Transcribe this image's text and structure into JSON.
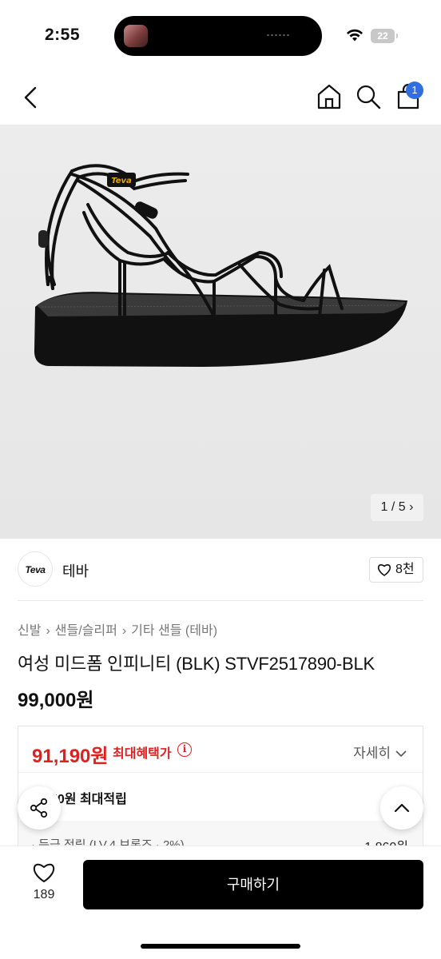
{
  "status_bar": {
    "time": "2:55",
    "battery": "22"
  },
  "nav": {
    "cart_badge": "1",
    "icons": [
      "chevron-left-icon",
      "home-icon",
      "search-icon",
      "cart-icon"
    ]
  },
  "hero": {
    "page_indicator": "1 / 5 ›"
  },
  "brand": {
    "logo_text": "Teva",
    "name": "테바",
    "likes": "8천"
  },
  "product": {
    "breadcrumb": [
      "신발",
      "샌들/슬리퍼",
      "기타 샌들 (테바)"
    ],
    "breadcrumb_sep": "›",
    "title": "여성 미드폼 인피니티 (BLK) STVF2517890-BLK",
    "price": "99,000원"
  },
  "benefit": {
    "price": "91,190원",
    "label": "최대혜택가",
    "details": "자세히",
    "points": "50원 최대적립",
    "grade_label": "· 등급 적립 (LV.4 브론즈 · 2%)",
    "grade_value": "1,860원"
  },
  "bottom": {
    "wish_count": "189",
    "buy_label": "구매하기"
  },
  "colors": {
    "accent_red": "#e02020",
    "badge_blue": "#2f6fe0",
    "buy_button": "#000000"
  }
}
